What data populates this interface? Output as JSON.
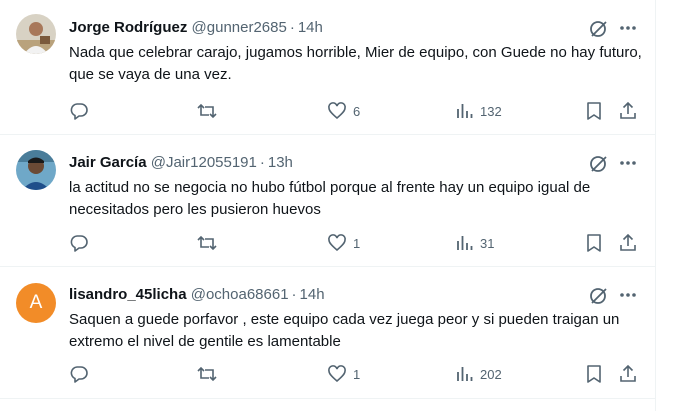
{
  "colors": {
    "text": "#0f1419",
    "muted": "#536471",
    "border": "#eff3f4",
    "avatar_letter_bg": "#f28c28"
  },
  "tweets": [
    {
      "name": "Jorge Rodríguez",
      "handle": "@gunner2685",
      "separator": "·",
      "time": "14h",
      "text": "Nada que celebrar carajo, jugamos horrible, Mier de equipo, con Guede no hay futuro, que se vaya de una vez.",
      "likes": "6",
      "views": "132",
      "avatar": "photo"
    },
    {
      "name": "Jair García",
      "handle": "@Jair12055191",
      "separator": "·",
      "time": "13h",
      "text": "la actitud no se negocia no hubo fútbol porque al frente hay un equipo igual de necesitados pero les pusieron huevos",
      "likes": "1",
      "views": "31",
      "avatar": "photo"
    },
    {
      "name": "lisandro_45licha",
      "handle": "@ochoa68661",
      "separator": "·",
      "time": "14h",
      "text": "Saquen a guede porfavor , este equipo cada vez juega peor y si pueden traigan un extremo el nivel de gentile es lamentable",
      "likes": "1",
      "views": "202",
      "avatar": "letter",
      "avatar_letter": "A"
    }
  ],
  "icons": [
    "reply-icon",
    "retweet-icon",
    "like-icon",
    "views-icon",
    "bookmark-icon",
    "share-icon",
    "grok-icon",
    "more-icon"
  ]
}
